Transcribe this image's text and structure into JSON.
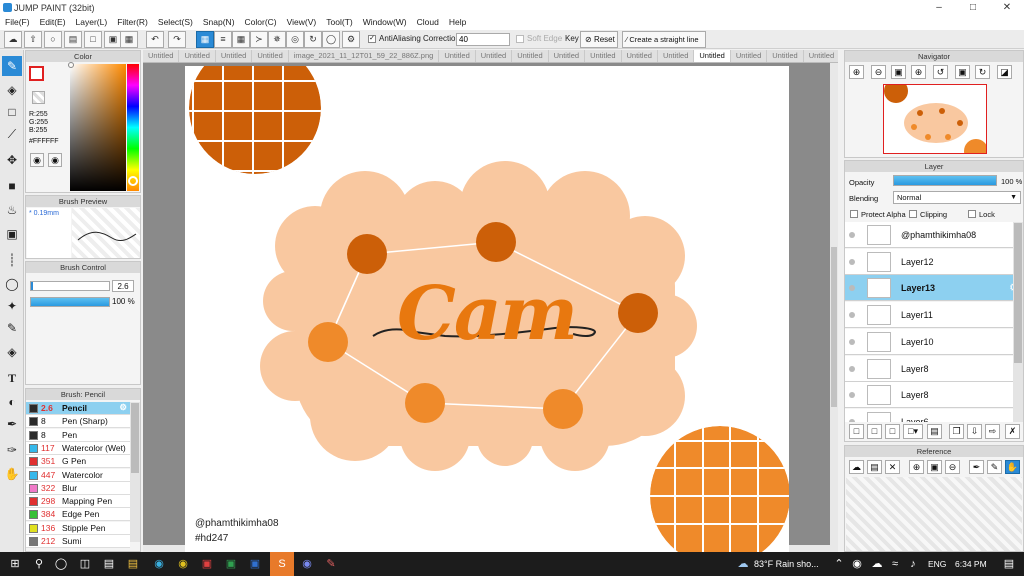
{
  "app": {
    "title": "JUMP PAINT (32bit)"
  },
  "menu": [
    "File(F)",
    "Edit(E)",
    "Layer(L)",
    "Filter(R)",
    "Select(S)",
    "Snap(N)",
    "Color(C)",
    "View(V)",
    "Tool(T)",
    "Window(W)",
    "Cloud",
    "Help"
  ],
  "toolbar": {
    "antialiasing": "AntiAliasing",
    "correction_label": "Correction",
    "correction_value": "40",
    "soft_edge": "Soft Edge",
    "key_label": "Key",
    "reset": "Reset",
    "straight_line": "Create a straight line"
  },
  "tabs": [
    "Untitled",
    "Untitled",
    "Untitled",
    "Untitled",
    "image_2021_11_12T01_59_22_886Z.png",
    "Untitled",
    "Untitled",
    "Untitled",
    "Untitled",
    "Untitled",
    "Untitled",
    "Untitled",
    "Untitled",
    "Untitled",
    "Untitled",
    "Untitled",
    "Untitled",
    "Untitled",
    "Untitled",
    "Untitled"
  ],
  "color_panel": {
    "title": "Color",
    "r": "R:255",
    "g": "G:255",
    "b": "B:255",
    "hex": "#FFFFFF"
  },
  "brush_preview": {
    "title": "Brush Preview",
    "size": "* 0.19mm"
  },
  "brush_control": {
    "title": "Brush Control",
    "size_value": "2.6",
    "opacity_value": "100 %",
    "opacity_fraction": 1.0
  },
  "brush_list": {
    "title": "Brush: Pencil",
    "items": [
      {
        "size": "2.6",
        "name": "Pencil",
        "color": "#2a2a2a",
        "size_color": "#e03030"
      },
      {
        "size": "8",
        "name": "Pen (Sharp)",
        "color": "#2a2a2a",
        "size_color": "#111111"
      },
      {
        "size": "8",
        "name": "Pen",
        "color": "#2a2a2a",
        "size_color": "#111111"
      },
      {
        "size": "117",
        "name": "Watercolor (Wet)",
        "color": "#35b8ea",
        "size_color": "#e03030"
      },
      {
        "size": "351",
        "name": "G Pen",
        "color": "#e03030",
        "size_color": "#e03030"
      },
      {
        "size": "447",
        "name": "Watercolor",
        "color": "#35b8ea",
        "size_color": "#e03030"
      },
      {
        "size": "322",
        "name": "Blur",
        "color": "#f07ac8",
        "size_color": "#e03030"
      },
      {
        "size": "298",
        "name": "Mapping Pen",
        "color": "#e03030",
        "size_color": "#e03030"
      },
      {
        "size": "384",
        "name": "Edge Pen",
        "color": "#35c035",
        "size_color": "#e03030"
      },
      {
        "size": "136",
        "name": "Stipple Pen",
        "color": "#e0e020",
        "size_color": "#e03030"
      },
      {
        "size": "212",
        "name": "Sumi",
        "color": "#777777",
        "size_color": "#e03030"
      }
    ]
  },
  "navigator": {
    "title": "Navigator"
  },
  "layer_panel": {
    "title": "Layer",
    "opacity_label": "Opacity",
    "opacity_value": "100 %",
    "opacity_fraction": 1.0,
    "blending_label": "Blending",
    "blending_value": "Normal",
    "protect_alpha": "Protect Alpha",
    "clipping": "Clipping",
    "lock": "Lock",
    "layers": [
      "@phamthikimha08",
      "Layer12",
      "Layer13",
      "Layer11",
      "Layer10",
      "Layer8",
      "Layer8",
      "Layer6"
    ],
    "selected_index": 2
  },
  "reference": {
    "title": "Reference"
  },
  "artwork": {
    "lettering": "Cam",
    "signature": "@phamthikimha08",
    "hashtag": "#hd247",
    "colors": {
      "dark_orange": "#cc5f08",
      "orange": "#ef8a2a",
      "light_orange": "#f9c8a0",
      "blue": "#2a8ad6"
    }
  },
  "taskbar": {
    "weather": "83°F Rain sho...",
    "language": "ENG",
    "time": "6:34 PM"
  }
}
